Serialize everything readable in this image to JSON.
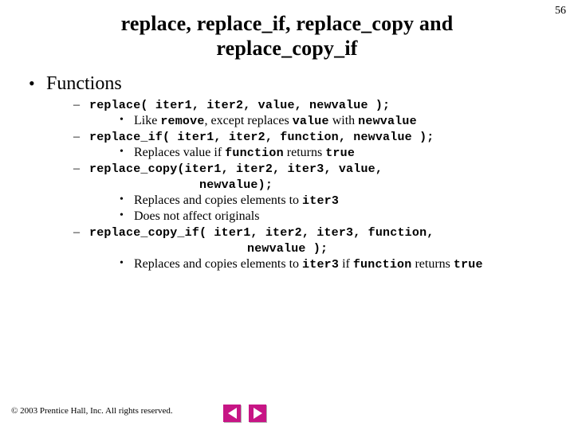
{
  "page_number": "56",
  "title_line1": "replace, replace_if, replace_copy and",
  "title_line2": "replace_copy_if",
  "heading_l1": "Functions",
  "items": [
    {
      "sig": "replace( iter1, iter2, value, newvalue );",
      "cont": null,
      "sub": [
        {
          "pre": "Like ",
          "m1": "remove",
          "mid": ", except replaces ",
          "m2": "value",
          "mid2": " with ",
          "m3": "newvalue",
          "post": ""
        }
      ]
    },
    {
      "sig": "replace_if( iter1, iter2, function, newvalue );",
      "cont": null,
      "sub": [
        {
          "pre": "Replaces value if ",
          "m1": "function",
          "mid": " returns ",
          "m2": "true",
          "mid2": "",
          "m3": "",
          "post": ""
        }
      ]
    },
    {
      "sig": "replace_copy(iter1, iter2, iter3, value,",
      "cont": "newvalue);",
      "sub": [
        {
          "pre": "Replaces and copies elements to ",
          "m1": "iter3",
          "mid": "",
          "m2": "",
          "mid2": "",
          "m3": "",
          "post": ""
        },
        {
          "pre": "Does not affect originals",
          "m1": "",
          "mid": "",
          "m2": "",
          "mid2": "",
          "m3": "",
          "post": ""
        }
      ]
    },
    {
      "sig": "replace_copy_if( iter1, iter2, iter3, function,",
      "cont": "newvalue );",
      "sub": [
        {
          "pre": "Replaces and copies elements to ",
          "m1": "iter3",
          "mid": " if ",
          "m2": "function",
          "mid2": " returns ",
          "m3": "true",
          "post": ""
        }
      ]
    }
  ],
  "footer": "© 2003 Prentice Hall, Inc.  All rights reserved."
}
